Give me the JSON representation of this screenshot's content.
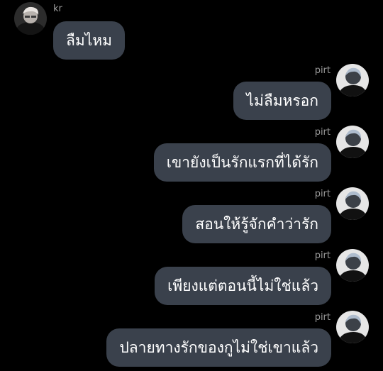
{
  "messages": [
    {
      "side": "in",
      "sender": "kr",
      "avatar": "avatar-kr",
      "text": "ลืมไหม"
    },
    {
      "side": "out",
      "sender": "pirt",
      "avatar": "avatar-pirt",
      "text": "ไม่ลืมหรอก"
    },
    {
      "side": "out",
      "sender": "pirt",
      "avatar": "avatar-pirt",
      "text": "เขายังเป็นรักแรกที่ได้รัก"
    },
    {
      "side": "out",
      "sender": "pirt",
      "avatar": "avatar-pirt",
      "text": "สอนให้รู้จักคำว่ารัก"
    },
    {
      "side": "out",
      "sender": "pirt",
      "avatar": "avatar-pirt",
      "text": "เพียงแต่ตอนนี้ไม่ใช่แล้ว"
    },
    {
      "side": "out",
      "sender": "pirt",
      "avatar": "avatar-pirt",
      "text": "ปลายทางรักของกูไม่ใช่เขาแล้ว"
    }
  ],
  "colors": {
    "background": "#000000",
    "bubble": "#3a414c",
    "bubble_text": "#ffffff",
    "sender_name": "#9a9a9a"
  }
}
